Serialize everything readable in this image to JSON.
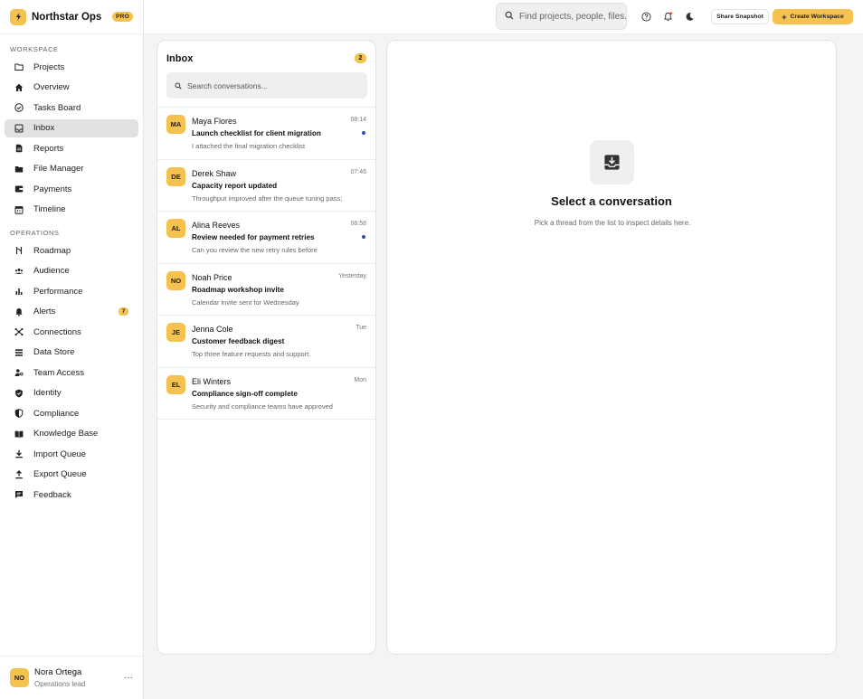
{
  "brand": {
    "name": "Northstar Ops",
    "badge": "PRO",
    "accent": "#f5c14f"
  },
  "sidebar": {
    "workspace_label": "WORKSPACE",
    "workspace_items": [
      {
        "label": "Projects",
        "icon": "folder-icon"
      },
      {
        "label": "Overview",
        "icon": "home-icon"
      },
      {
        "label": "Tasks Board",
        "icon": "check-circle-icon"
      },
      {
        "label": "Inbox",
        "icon": "inbox-icon",
        "active": true
      },
      {
        "label": "Reports",
        "icon": "document-icon"
      },
      {
        "label": "File Manager",
        "icon": "folder-filled-icon"
      },
      {
        "label": "Payments",
        "icon": "wallet-icon"
      },
      {
        "label": "Timeline",
        "icon": "calendar-icon"
      }
    ],
    "operations_label": "OPERATIONS",
    "operations_items": [
      {
        "label": "Roadmap",
        "icon": "route-icon"
      },
      {
        "label": "Audience",
        "icon": "users-icon"
      },
      {
        "label": "Performance",
        "icon": "bar-chart-icon"
      },
      {
        "label": "Alerts",
        "icon": "bell-icon",
        "badge": "7"
      },
      {
        "label": "Connections",
        "icon": "network-icon"
      },
      {
        "label": "Data Store",
        "icon": "list-icon"
      },
      {
        "label": "Team Access",
        "icon": "user-key-icon"
      },
      {
        "label": "Identity",
        "icon": "shield-check-icon"
      },
      {
        "label": "Compliance",
        "icon": "shield-half-icon"
      },
      {
        "label": "Knowledge Base",
        "icon": "book-icon"
      },
      {
        "label": "Import Queue",
        "icon": "download-icon"
      },
      {
        "label": "Export Queue",
        "icon": "upload-icon"
      },
      {
        "label": "Feedback",
        "icon": "chat-icon"
      }
    ],
    "user": {
      "initials": "NO",
      "name": "Nora Ortega",
      "role": "Operations lead",
      "more": "···"
    }
  },
  "header": {
    "search_placeholder": "Find projects, people, files...",
    "share_label": "Share Snapshot",
    "create_label": "Create Workspace"
  },
  "inbox": {
    "title": "Inbox",
    "count": "2",
    "search_placeholder": "Search conversations...",
    "conversations": [
      {
        "initials": "MA",
        "name": "Maya Flores",
        "time": "08:14",
        "subject": "Launch checklist for client migration",
        "preview": "I attached the final migration checklist",
        "unread": true
      },
      {
        "initials": "DE",
        "name": "Derek Shaw",
        "time": "07:46",
        "subject": "Capacity report updated",
        "preview": "Throughput improved after the queue tuning pass;",
        "unread": false
      },
      {
        "initials": "AL",
        "name": "Alina Reeves",
        "time": "06:58",
        "subject": "Review needed for payment retries",
        "preview": "Can you review the new retry rules before",
        "unread": true
      },
      {
        "initials": "NO",
        "name": "Noah Price",
        "time": "Yesterday",
        "subject": "Roadmap workshop invite",
        "preview": "Calendar invite sent for Wednesday",
        "unread": false
      },
      {
        "initials": "JE",
        "name": "Jenna Cole",
        "time": "Tue",
        "subject": "Customer feedback digest",
        "preview": "Top three feature requests and support.",
        "unread": false
      },
      {
        "initials": "EL",
        "name": "Eli Winters",
        "time": "Mon",
        "subject": "Compliance sign-off complete",
        "preview": "Security and compliance teams have approved",
        "unread": false
      }
    ]
  },
  "detail": {
    "empty_title": "Select a conversation",
    "empty_desc": "Pick a thread from the list to inspect details here."
  }
}
